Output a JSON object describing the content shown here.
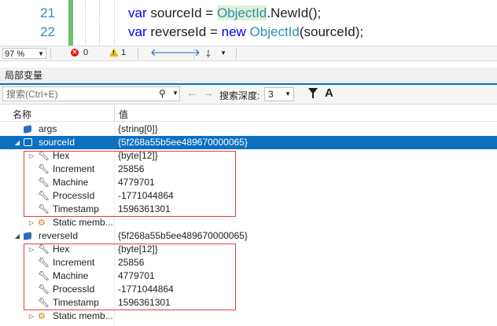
{
  "editor": {
    "lines": [
      {
        "number": "21",
        "parts": [
          [
            "kw",
            "var"
          ],
          [
            "",
            "sourceId = "
          ],
          [
            "tyhl",
            "ObjectId"
          ],
          [
            "",
            ".NewId();"
          ]
        ]
      },
      {
        "number": "22",
        "parts": [
          [
            "kw",
            "var"
          ],
          [
            "",
            "reverseId = "
          ],
          [
            "kw",
            "new"
          ],
          [
            "ty",
            "ObjectId"
          ],
          [
            "",
            "(sourceId);"
          ]
        ]
      }
    ]
  },
  "status": {
    "zoom": "97 %",
    "errors": "0",
    "warnings": "1"
  },
  "panel": {
    "title": "局部变量",
    "search_placeholder": "搜索(Ctrl+E)",
    "depth_label": "搜索深度:",
    "depth_value": "3",
    "a_label": "A"
  },
  "grid": {
    "col_name": "名称",
    "col_value": "值",
    "rows": [
      {
        "name": "args",
        "value": "{string[0]}",
        "indent": 0,
        "icon": "cube",
        "expander": ""
      },
      {
        "name": "sourceId",
        "value": "{5f268a55b5ee489670000065}",
        "indent": 0,
        "icon": "cube",
        "expander": "◢",
        "selected": true
      },
      {
        "name": "Hex",
        "value": "{byte[12]}",
        "indent": 1,
        "icon": "wrench",
        "expander": "▷"
      },
      {
        "name": "Increment",
        "value": "25856",
        "indent": 1,
        "icon": "wrench",
        "expander": ""
      },
      {
        "name": "Machine",
        "value": "4779701",
        "indent": 1,
        "icon": "wrench",
        "expander": ""
      },
      {
        "name": "ProcessId",
        "value": "-1771044864",
        "indent": 1,
        "icon": "wrench",
        "expander": ""
      },
      {
        "name": "Timestamp",
        "value": "1596361301",
        "indent": 1,
        "icon": "wrench",
        "expander": ""
      },
      {
        "name": "Static memb...",
        "value": "",
        "indent": 1,
        "icon": "static",
        "expander": "▷"
      },
      {
        "name": "reverseId",
        "value": "{5f268a55b5ee489670000065}",
        "indent": 0,
        "icon": "cube",
        "expander": "◢"
      },
      {
        "name": "Hex",
        "value": "{byte[12]}",
        "indent": 1,
        "icon": "wrench",
        "expander": "▷"
      },
      {
        "name": "Increment",
        "value": "25856",
        "indent": 1,
        "icon": "wrench",
        "expander": ""
      },
      {
        "name": "Machine",
        "value": "4779701",
        "indent": 1,
        "icon": "wrench",
        "expander": ""
      },
      {
        "name": "ProcessId",
        "value": "-1771044864",
        "indent": 1,
        "icon": "wrench",
        "expander": ""
      },
      {
        "name": "Timestamp",
        "value": "1596361301",
        "indent": 1,
        "icon": "wrench",
        "expander": ""
      },
      {
        "name": "Static memb...",
        "value": "",
        "indent": 1,
        "icon": "static",
        "expander": "▷"
      }
    ]
  },
  "colors": {
    "selection": "#0e70c0",
    "highlight_box": "#e13d3d",
    "keyword": "#0000ff",
    "type": "#2b91af"
  }
}
